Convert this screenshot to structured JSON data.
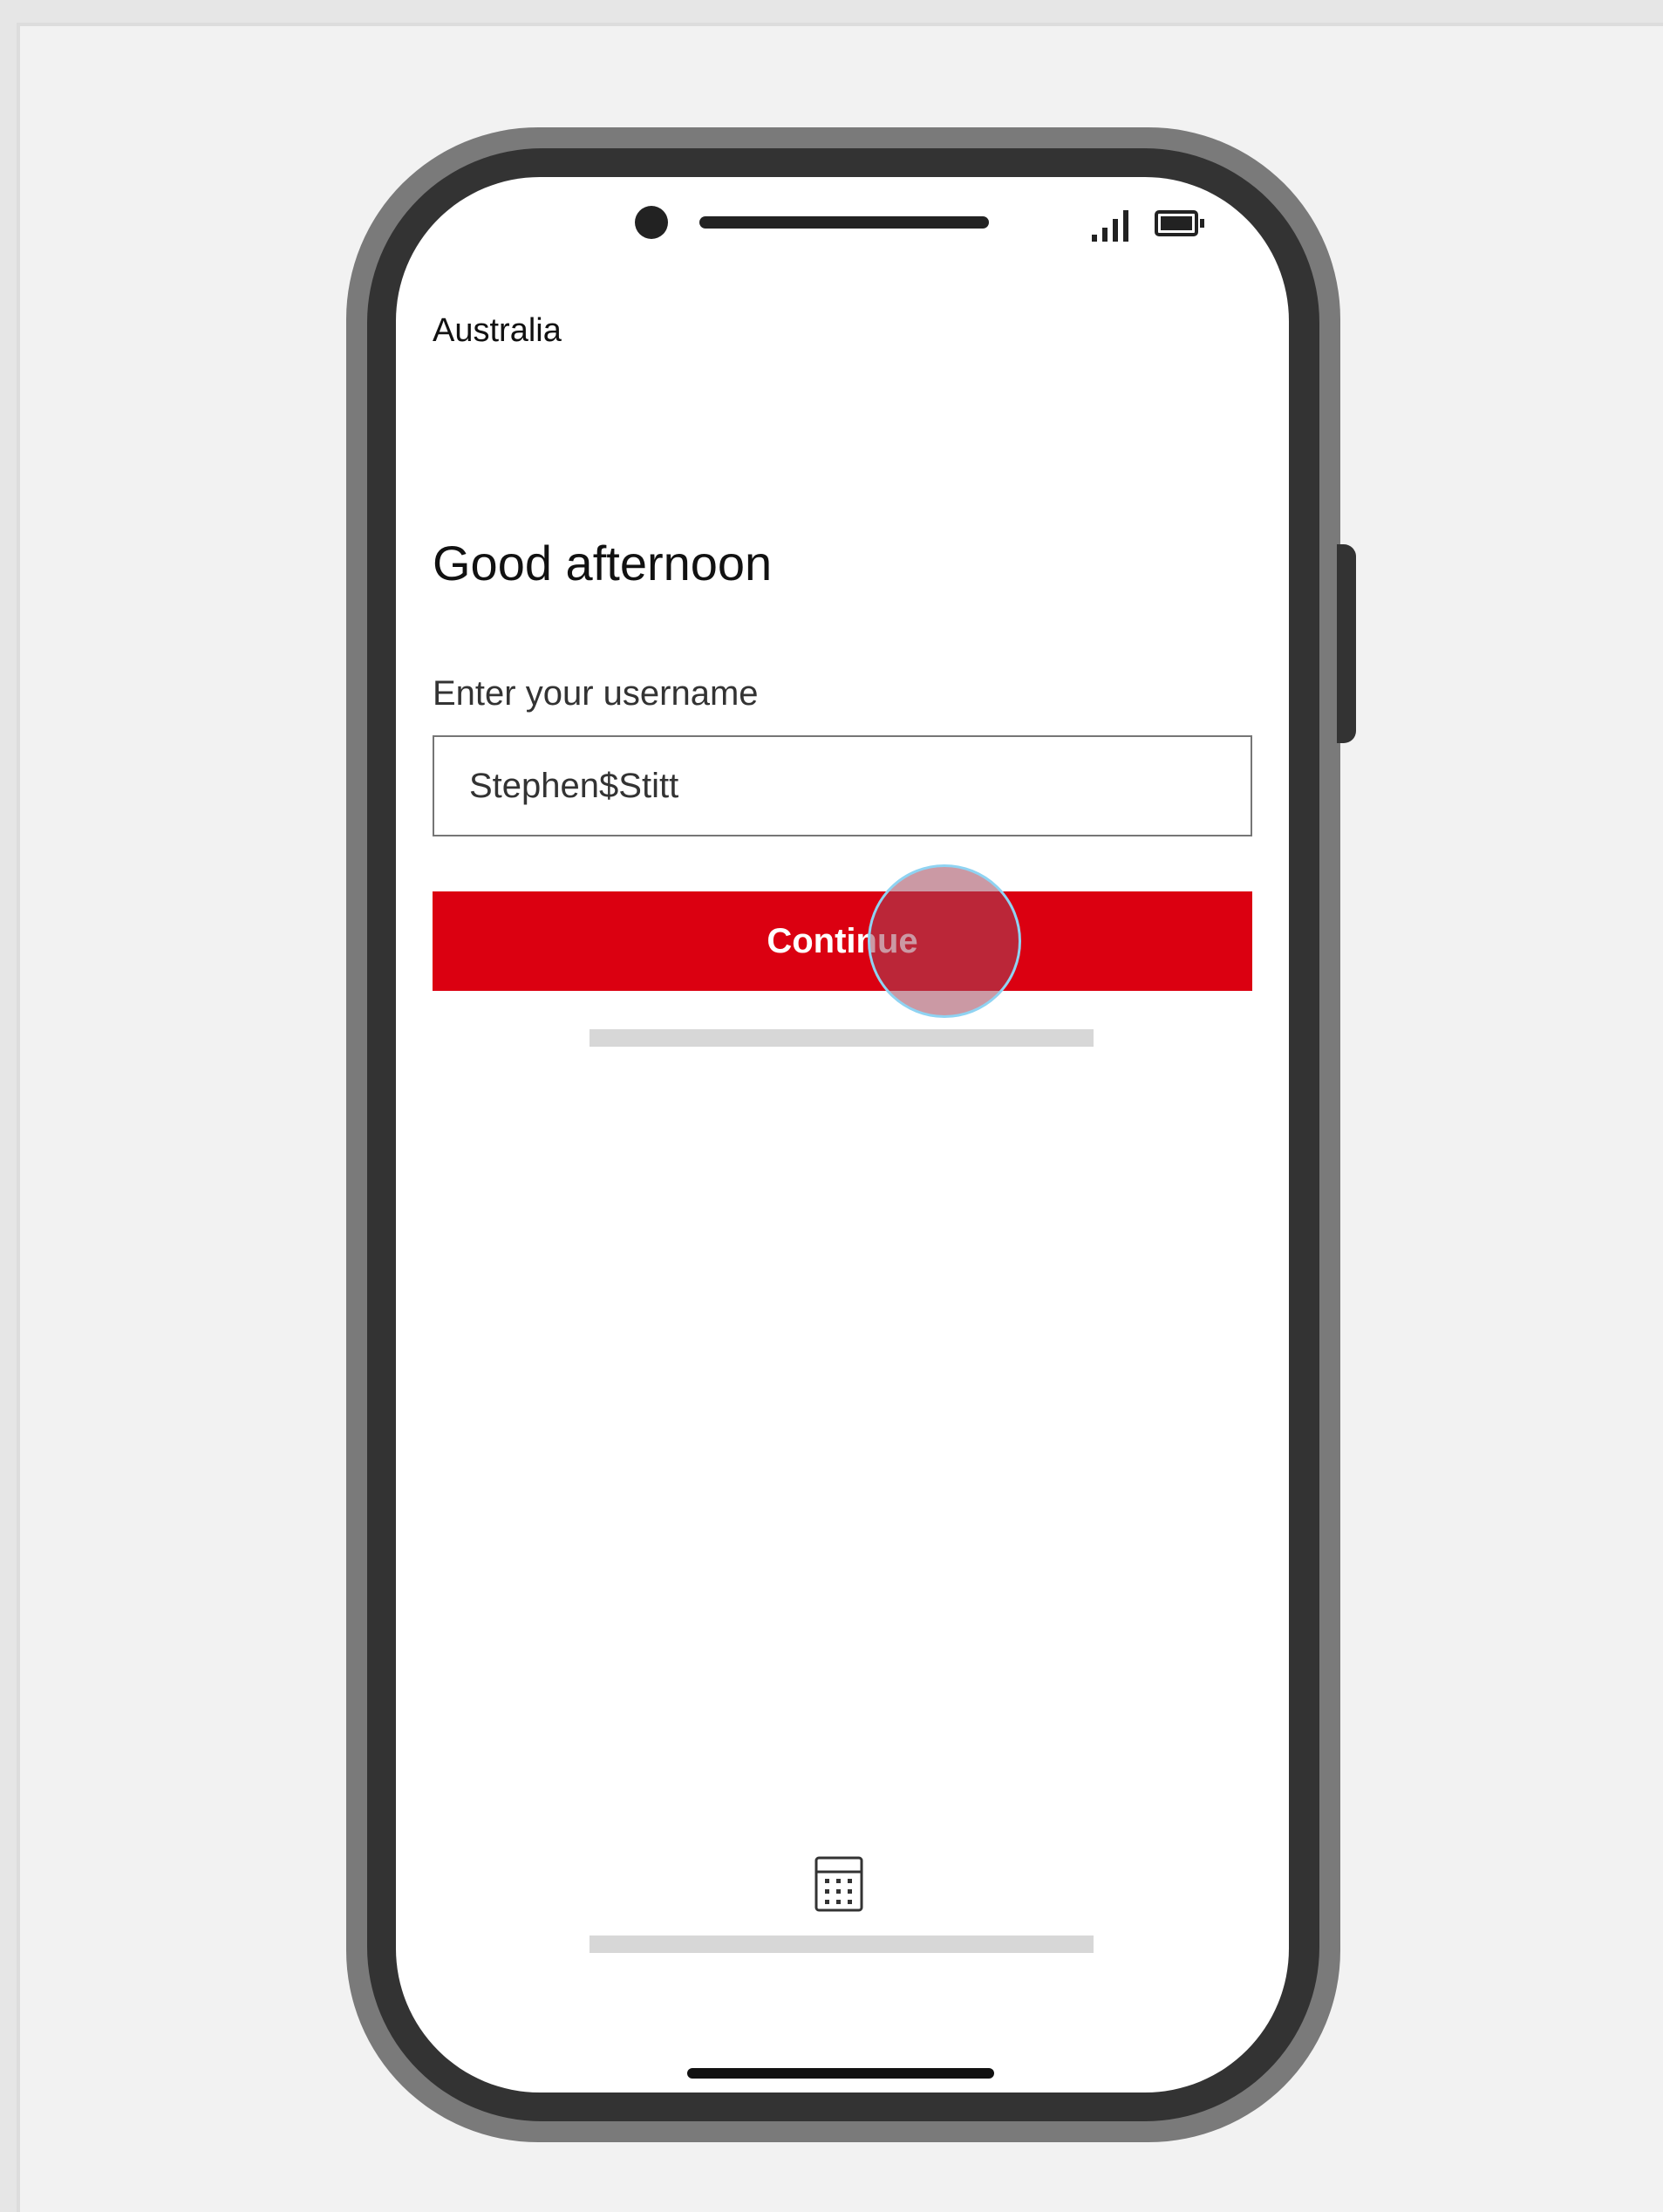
{
  "status_bar": {
    "camera_icon": "camera-dot",
    "speaker_icon": "earpiece-bar",
    "signal_icon": "cellular-signal",
    "battery_icon": "battery-full"
  },
  "header": {
    "region": "Australia"
  },
  "main": {
    "greeting": "Good afternoon",
    "username_label": "Enter your username",
    "username_value": "Stephen$Stitt",
    "continue_label": "Continue"
  },
  "footer": {
    "calculator_icon": "calculator-icon"
  },
  "colors": {
    "brand_red": "#db0011",
    "tap_indicator_border": "#8fd3f2"
  }
}
